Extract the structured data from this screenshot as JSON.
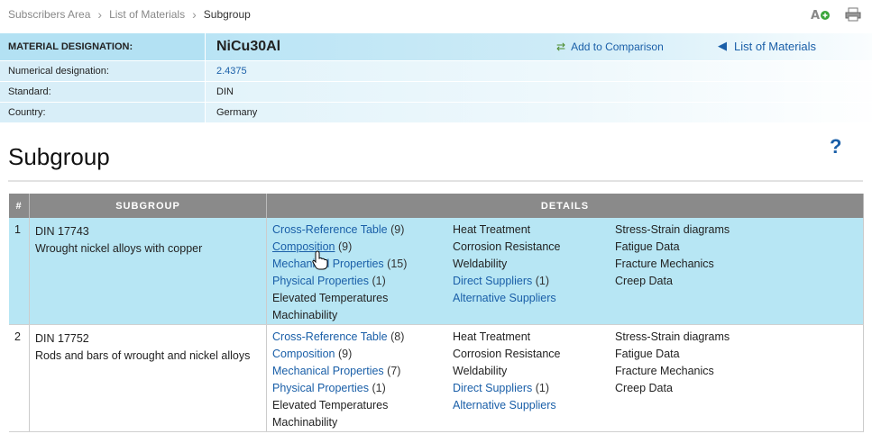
{
  "breadcrumb": {
    "items": [
      "Subscribers Area",
      "List of Materials"
    ],
    "current": "Subgroup"
  },
  "info": {
    "designation_label": "MATERIAL DESIGNATION:",
    "designation_value": "NiCu30Al",
    "add_comparison": "Add to Comparison",
    "list_materials": "List of Materials",
    "rows": [
      {
        "label": "Numerical designation:",
        "value": "2.4375"
      },
      {
        "label": "Standard:",
        "value": "DIN"
      },
      {
        "label": "Country:",
        "value": "Germany"
      }
    ]
  },
  "page_title": "Subgroup",
  "help": "?",
  "table": {
    "headers": [
      "#",
      "SUBGROUP",
      "DETAILS"
    ],
    "rows": [
      {
        "num": "1",
        "code": "DIN 17743",
        "name": "Wrought nickel alloys with copper",
        "col1": [
          {
            "text": "Cross-Reference Table",
            "count": "(9)",
            "link": true
          },
          {
            "text": "Composition",
            "count": "(9)",
            "link": true
          },
          {
            "text": "Mechanical Properties",
            "count": "(15)",
            "link": true
          },
          {
            "text": "Physical Properties",
            "count": "(1)",
            "link": true
          },
          {
            "text": "Elevated Temperatures",
            "count": "",
            "link": false
          },
          {
            "text": "Machinability",
            "count": "",
            "link": false
          }
        ],
        "col2": [
          {
            "text": "Heat Treatment",
            "count": "",
            "link": false
          },
          {
            "text": "Corrosion Resistance",
            "count": "",
            "link": false
          },
          {
            "text": "Weldability",
            "count": "",
            "link": false
          },
          {
            "text": "Direct Suppliers",
            "count": "(1)",
            "link": true
          },
          {
            "text": "Alternative Suppliers",
            "count": "",
            "link": true
          }
        ],
        "col3": [
          "Stress-Strain diagrams",
          "Fatigue Data",
          "Fracture Mechanics",
          "Creep Data"
        ]
      },
      {
        "num": "2",
        "code": "DIN 17752",
        "name": "Rods and bars of wrought and nickel alloys",
        "col1": [
          {
            "text": "Cross-Reference Table",
            "count": "(8)",
            "link": true
          },
          {
            "text": "Composition",
            "count": "(9)",
            "link": true
          },
          {
            "text": "Mechanical Properties",
            "count": "(7)",
            "link": true
          },
          {
            "text": "Physical Properties",
            "count": "(1)",
            "link": true
          },
          {
            "text": "Elevated Temperatures",
            "count": "",
            "link": false
          },
          {
            "text": "Machinability",
            "count": "",
            "link": false
          }
        ],
        "col2": [
          {
            "text": "Heat Treatment",
            "count": "",
            "link": false
          },
          {
            "text": "Corrosion Resistance",
            "count": "",
            "link": false
          },
          {
            "text": "Weldability",
            "count": "",
            "link": false
          },
          {
            "text": "Direct Suppliers",
            "count": "(1)",
            "link": true
          },
          {
            "text": "Alternative Suppliers",
            "count": "",
            "link": true
          }
        ],
        "col3": [
          "Stress-Strain diagrams",
          "Fatigue Data",
          "Fracture Mechanics",
          "Creep Data"
        ]
      }
    ]
  },
  "colors": {
    "link": "#1a5fa8",
    "highlight_row": "#b7e6f4",
    "header_bg": "#8a8a8a"
  },
  "icons": [
    "chevron-right-icon",
    "add-font-icon",
    "print-icon",
    "compare-arrows-icon",
    "back-triangle-icon",
    "help-icon",
    "hand-cursor-icon"
  ]
}
